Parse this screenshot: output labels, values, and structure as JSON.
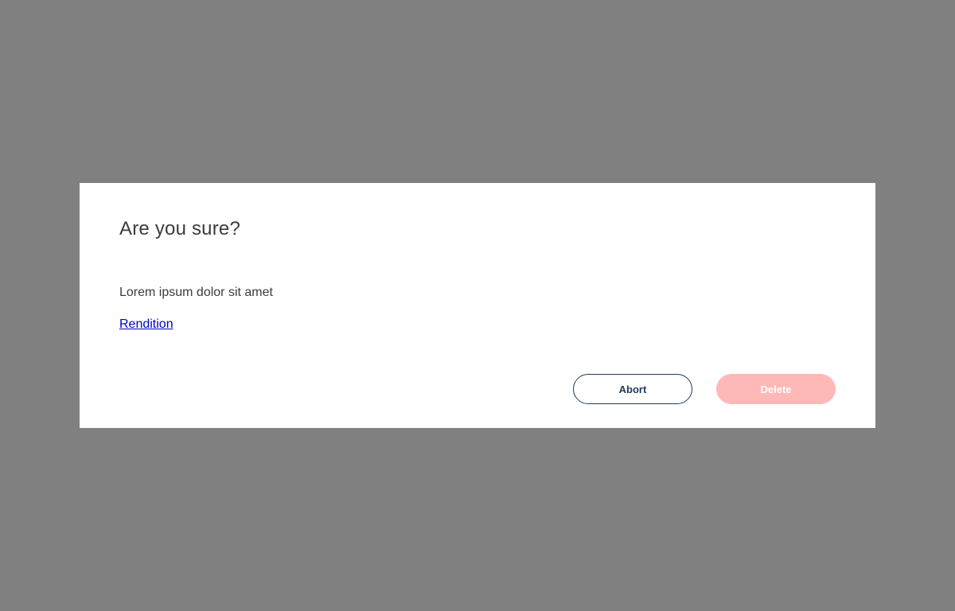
{
  "dialog": {
    "title": "Are you sure?",
    "message": "Lorem ipsum dolor sit amet",
    "link_label": "Rendition",
    "abort_label": "Abort",
    "delete_label": "Delete",
    "delete_disabled": true
  },
  "colors": {
    "overlay": "#808080",
    "dialog_background": "#ffffff",
    "text": "#3c3c3c",
    "link": "#0000cc",
    "abort_border": "#1d3c5c",
    "delete_background": "#ffb8b8"
  }
}
